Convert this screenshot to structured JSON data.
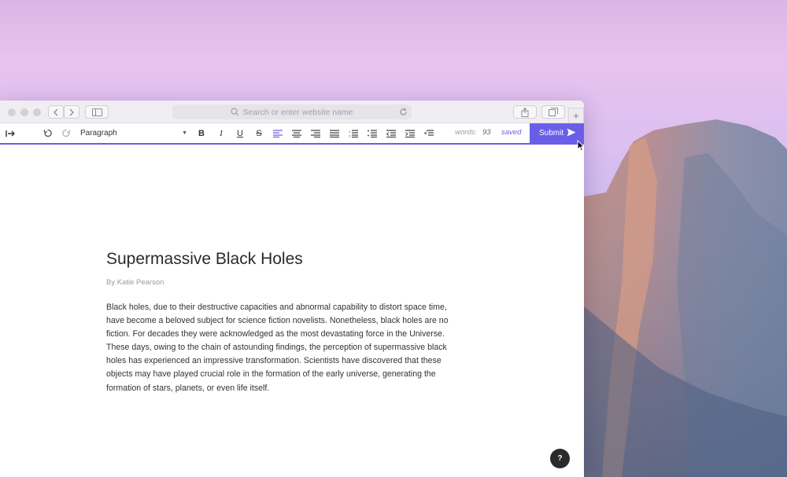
{
  "browser": {
    "url_placeholder": "Search or enter website name",
    "new_tab_label": "+"
  },
  "toolbar": {
    "block_format": "Paragraph",
    "bold_label": "B",
    "italic_label": "I",
    "underline_label": "U",
    "strike_label": "S",
    "words_label": "words:",
    "words_count": "93",
    "status": "saved",
    "submit_label": "Submit"
  },
  "document": {
    "title": "Supermassive Black Holes",
    "author": "By Katie Pearson",
    "body": "Black holes, due to their destructive capacities and abnormal capability to distort space time, have become a beloved subject for science fiction novelists. Nonetheless, black holes are no fiction. For decades they were acknowledged as the most devastating force in the Universe. These days, owing to the chain of astounding findings, the perception of supermassive black holes has experienced an impressive transformation. Scientists have discovered that these objects may have played crucial role in the formation of the early universe, generating the formation of stars, planets, or even life itself."
  },
  "help_label": "?",
  "colors": {
    "accent": "#6a5ee8",
    "help_button": "#2a2a2d"
  }
}
